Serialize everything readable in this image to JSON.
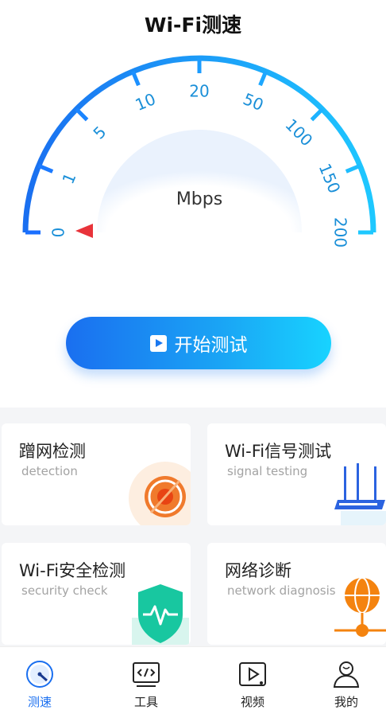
{
  "header": {
    "title": "Wi-Fi测速"
  },
  "gauge": {
    "unit": "Mbps",
    "ticks": [
      "0",
      "1",
      "5",
      "10",
      "20",
      "50",
      "100",
      "150",
      "200"
    ],
    "value": 0,
    "colors": {
      "start": "#1a6ff0",
      "end": "#1ec8ff",
      "pointer": "#e8333a"
    }
  },
  "start_button": {
    "label": "开始测试",
    "icon": "play-icon"
  },
  "cards": [
    {
      "title": "蹭网检测",
      "subtitle": "detection",
      "icon": "radar-icon"
    },
    {
      "title": "Wi-Fi信号测试",
      "subtitle": "signal testing",
      "icon": "router-icon"
    },
    {
      "title": "Wi-Fi安全检测",
      "subtitle": "security check",
      "icon": "shield-icon"
    },
    {
      "title": "网络诊断",
      "subtitle": "network diagnosis",
      "icon": "globe-network-icon"
    }
  ],
  "tabbar": {
    "items": [
      {
        "label": "测速",
        "icon": "speedometer-icon",
        "active": true
      },
      {
        "label": "工具",
        "icon": "code-tool-icon",
        "active": false
      },
      {
        "label": "视频",
        "icon": "video-icon",
        "active": false
      },
      {
        "label": "我的",
        "icon": "user-icon",
        "active": false
      }
    ]
  }
}
